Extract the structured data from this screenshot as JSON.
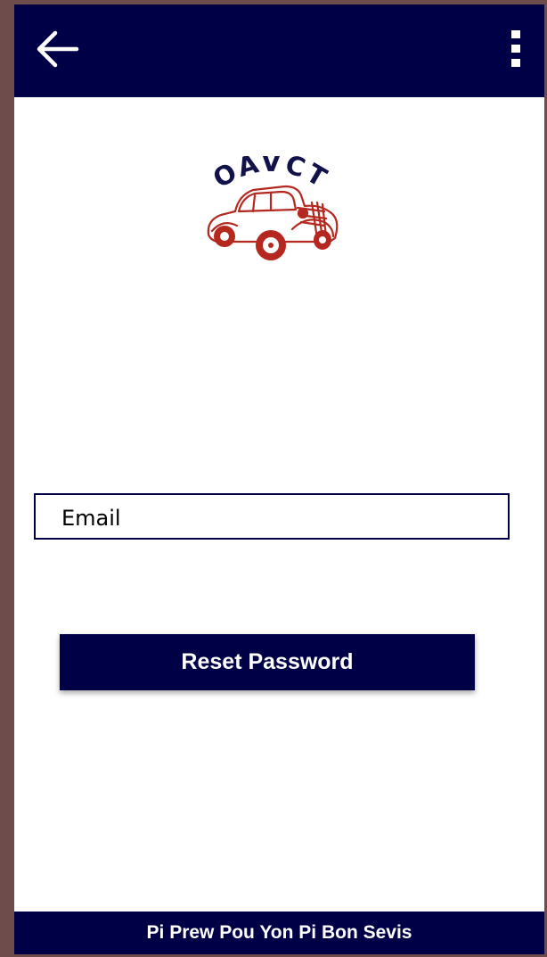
{
  "appbar": {
    "back_icon": "arrow-left-icon",
    "menu_icon": "more-vertical-icon",
    "background_color": "#000046"
  },
  "logo": {
    "text": "OAVCT",
    "text_color": "#12124a",
    "car_color": "#b5281f"
  },
  "form": {
    "email_placeholder": "Email",
    "reset_label": "Reset Password"
  },
  "footer": {
    "text": "Pi Prew Pou Yon Pi Bon Sevis"
  },
  "colors": {
    "primary": "#000046",
    "frame": "#6e4c4b",
    "surface": "#ffffff"
  }
}
